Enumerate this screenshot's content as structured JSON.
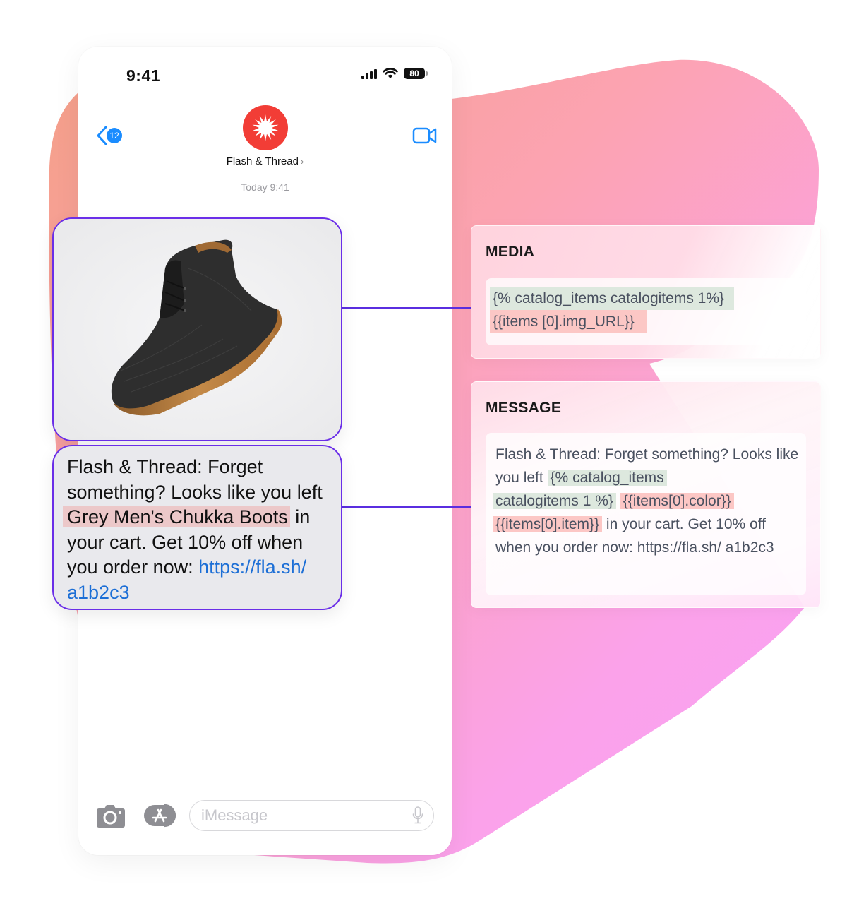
{
  "status_bar": {
    "time": "9:41",
    "battery": "80",
    "icons": [
      "cellular-signal-icon",
      "wifi-icon",
      "battery-icon"
    ]
  },
  "header": {
    "back_badge_count": "12",
    "contact_name": "Flash & Thread",
    "contact_chevron": "›",
    "avatar_icon": "starburst-logo-icon",
    "video_icon": "video-camera-icon"
  },
  "conversation": {
    "timestamp": "Today 9:41",
    "image_message": {
      "alt": "Grey Men's Chukka Boot product photo"
    },
    "text_message": {
      "prefix": "Flash & Thread: Forget something? Looks like you left ",
      "product": "Grey Men's Chukka Boots",
      "middle": " in your cart. Get 10% off when you order now: ",
      "link_line1": "https://fla.sh/",
      "link_line2": "a1b2c3"
    }
  },
  "input_bar": {
    "placeholder": "iMessage",
    "camera_icon": "camera-icon",
    "apps_icon": "app-store-icon",
    "mic_icon": "microphone-icon"
  },
  "panels": {
    "media": {
      "title": "MEDIA",
      "line1": "{% catalog_items catalogitems 1%}",
      "line2": "{{items [0].img_URL}}"
    },
    "message": {
      "title": "MESSAGE",
      "text1": "Flash & Thread: Forget something? Looks like you left ",
      "tag1a": "{% catalog_items",
      "tag1b": "catalogitems 1 %}",
      "tag2": "{{items[0].color}}",
      "tag3": "{{items[0].item}}",
      "text2": " in your cart. Get 10% off when you order now: https://fla.sh/ a1b2c3"
    }
  },
  "colors": {
    "accent_outline": "#6a2ee8",
    "ios_blue": "#1a8cff",
    "brand_red": "#f23d36",
    "tag_green": "#dde8de",
    "tag_red": "#fcc7c5",
    "blob_gradient": [
      "#f4a08a",
      "#fca3b9",
      "#fba2f4"
    ]
  }
}
